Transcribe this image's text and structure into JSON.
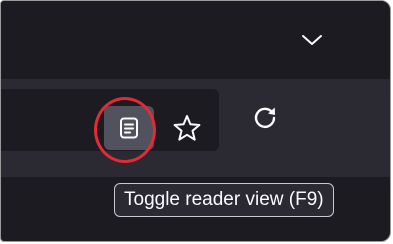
{
  "colors": {
    "tab_strip_bg": "#1c1b22",
    "toolbar_bg": "#2b2a33",
    "urlbar_bg": "#1c1b22",
    "reader_button_bg": "#52525e",
    "highlight": "#e22b34",
    "icon": "#fbfbfe"
  },
  "toolbar": {
    "tab_list_icon": "chevron-down-icon",
    "reader_view_icon": "reader-view-icon",
    "bookmark_icon": "star-outline-icon",
    "reload_icon": "reload-icon"
  },
  "tooltip": {
    "text": "Toggle reader view (F9)"
  }
}
